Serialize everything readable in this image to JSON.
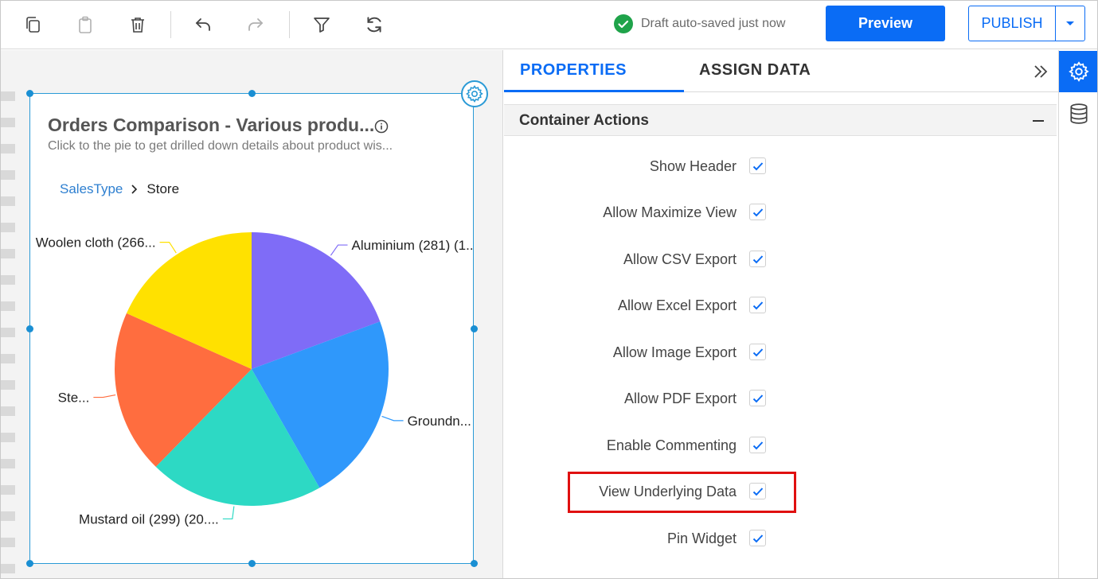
{
  "toolbar": {
    "icons": [
      "copy-icon",
      "paste-icon",
      "delete-icon",
      "undo-icon",
      "redo-icon",
      "filter-icon",
      "refresh-icon"
    ],
    "saved_status": "Draft auto-saved just now",
    "preview_label": "Preview",
    "publish_label": "PUBLISH"
  },
  "widget": {
    "title": "Orders Comparison - Various produ...",
    "subtitle": "Click to the pie to get drilled down details about product wis...",
    "breadcrumb": {
      "root": "SalesType",
      "current": "Store"
    }
  },
  "chart_data": {
    "type": "pie",
    "slices": [
      {
        "label": "Aluminium (281) (1...",
        "value": 281,
        "color": "#7f6cf7"
      },
      {
        "label": "Groundn...",
        "value": 325,
        "color": "#2f98fb"
      },
      {
        "label": "Mustard oil (299) (20....",
        "value": 299,
        "color": "#2dd9c4"
      },
      {
        "label": "Ste...",
        "value": 281,
        "color": "#ff6d3f"
      },
      {
        "label": "Woolen cloth (266...",
        "value": 266,
        "color": "#ffe100"
      }
    ]
  },
  "panel": {
    "tabs": [
      {
        "label": "PROPERTIES",
        "active": true
      },
      {
        "label": "ASSIGN DATA",
        "active": false
      }
    ],
    "section_title": "Container Actions",
    "properties": [
      {
        "label": "Show Header",
        "checked": true
      },
      {
        "label": "Allow Maximize View",
        "checked": true
      },
      {
        "label": "Allow CSV Export",
        "checked": true
      },
      {
        "label": "Allow Excel Export",
        "checked": true
      },
      {
        "label": "Allow Image Export",
        "checked": true
      },
      {
        "label": "Allow PDF Export",
        "checked": true
      },
      {
        "label": "Enable Commenting",
        "checked": true
      },
      {
        "label": "View Underlying Data",
        "checked": true,
        "highlighted": true
      },
      {
        "label": "Pin Widget",
        "checked": true
      }
    ]
  },
  "rail": {
    "icons": [
      "settings-icon",
      "database-icon"
    ],
    "active_index": 0
  },
  "colors": {
    "accent": "#0a6cf5",
    "widget_border": "#2a9ad6",
    "highlight": "#e01010",
    "saved_check": "#1fa34a"
  }
}
